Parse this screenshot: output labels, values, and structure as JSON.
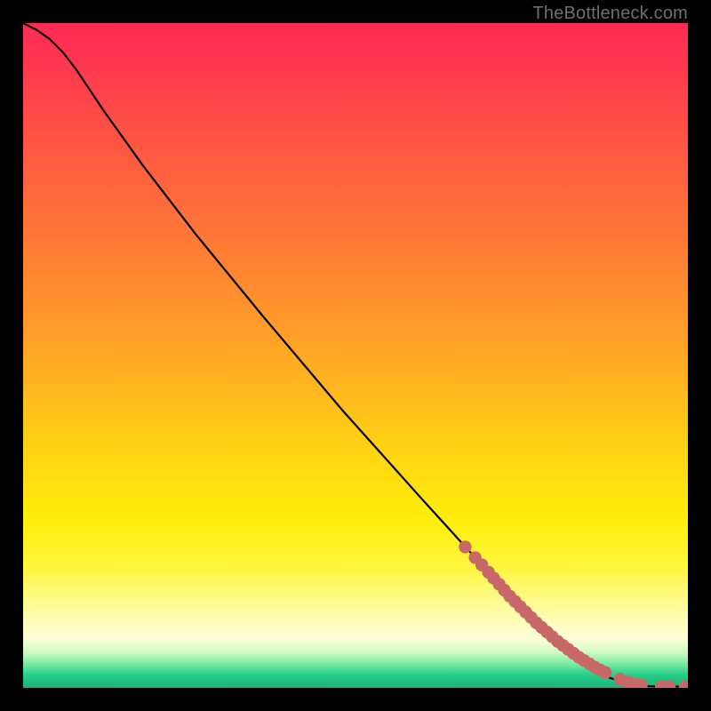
{
  "attribution": "TheBottleneck.com",
  "colors": {
    "line": "#000000",
    "marker": "#c96869",
    "frame": "#000000"
  },
  "chart_data": {
    "type": "line",
    "title": "",
    "xlabel": "",
    "ylabel": "",
    "xlim": [
      0,
      100
    ],
    "ylim": [
      0,
      100
    ],
    "grid": false,
    "legend": false,
    "note": "Axes have no tick labels; values are fractional coordinates (0–100) read off the plot area. Curve starts top-left, bends, then runs nearly straight to the bottom-right floor where markers lie.",
    "series": [
      {
        "name": "curve",
        "x": [
          0,
          2,
          4,
          6,
          8,
          12,
          18,
          26,
          36,
          48,
          60,
          68,
          72,
          76,
          80,
          84,
          88,
          91,
          93.5,
          95.5,
          97.3,
          98.7,
          100
        ],
        "y": [
          100,
          99,
          97.6,
          95.6,
          93.0,
          87.0,
          78.6,
          68.2,
          56.0,
          41.8,
          28.4,
          19.6,
          15.2,
          11.0,
          7.2,
          4.0,
          1.6,
          0.6,
          0.28,
          0.2,
          0.2,
          0.2,
          0.2
        ]
      }
    ],
    "markers": {
      "name": "highlight-dots",
      "x": [
        66.5,
        68.0,
        69.0,
        70.0,
        70.8,
        71.6,
        72.4,
        73.2,
        74.0,
        74.8,
        75.6,
        76.4,
        77.2,
        78.0,
        78.8,
        79.6,
        80.4,
        81.2,
        82.0,
        82.8,
        83.6,
        84.4,
        85.2,
        86.0,
        86.8,
        87.6,
        89.8,
        91.0,
        92.0,
        93.0,
        96.0,
        97.2,
        99.6,
        100
      ],
      "y": [
        21.2,
        19.6,
        18.5,
        17.4,
        16.5,
        15.6,
        14.7,
        13.8,
        13.0,
        12.2,
        11.4,
        10.6,
        9.8,
        9.1,
        8.4,
        7.7,
        7.0,
        6.4,
        5.8,
        5.2,
        4.6,
        4.1,
        3.6,
        3.1,
        2.7,
        2.3,
        1.3,
        0.9,
        0.6,
        0.4,
        0.2,
        0.2,
        0.2,
        0.2
      ]
    }
  }
}
